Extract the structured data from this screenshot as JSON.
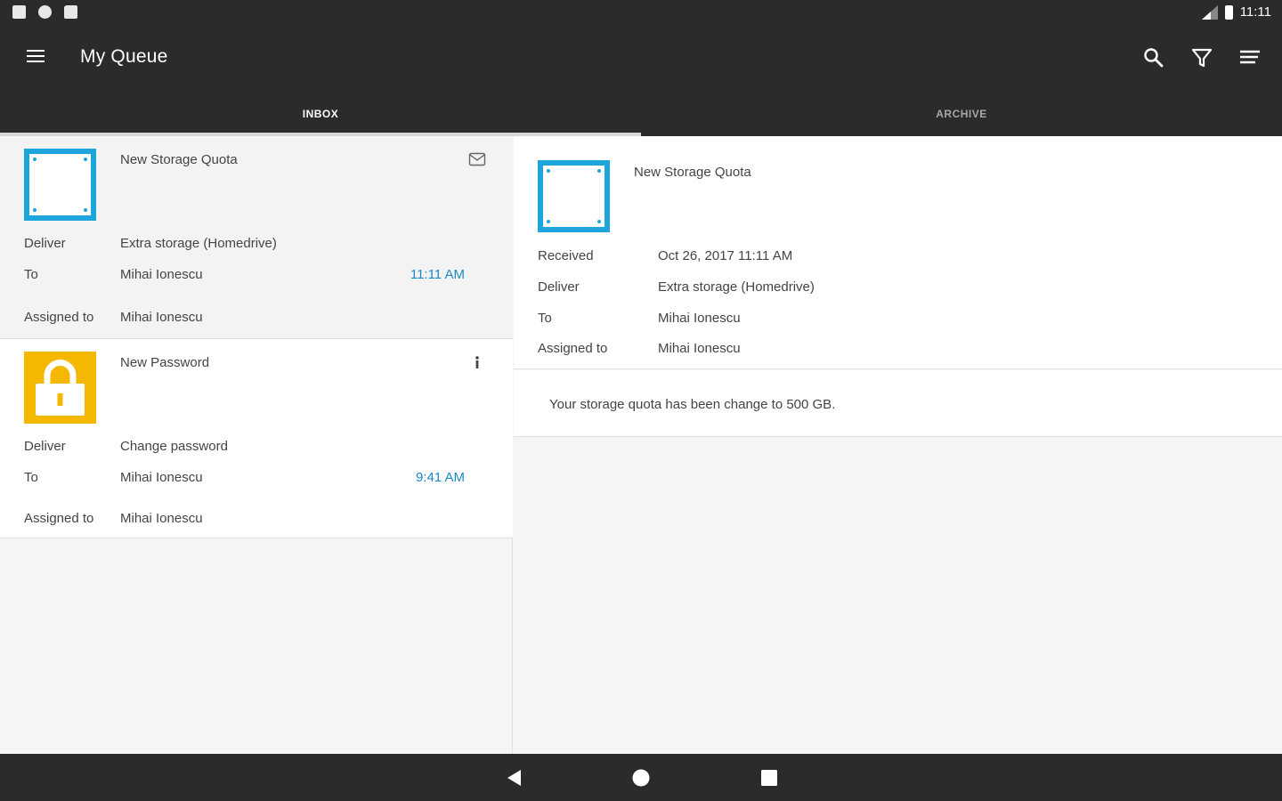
{
  "status_bar": {
    "time": "11:11"
  },
  "app_bar": {
    "title": "My Queue"
  },
  "tabs": [
    {
      "label": "INBOX",
      "active": true
    },
    {
      "label": "ARCHIVE",
      "active": false
    }
  ],
  "list": {
    "items": [
      {
        "title": "New Storage Quota",
        "icon": "mail-icon",
        "thumbnail": "storage-icon",
        "thumbnail_color": "#1ea5dc",
        "deliver_label": "Deliver",
        "deliver_value": "Extra storage (Homedrive)",
        "to_label": "To",
        "to_value": "Mihai Ionescu",
        "time": "11:11 AM",
        "assigned_label": "Assigned to",
        "assigned_value": "Mihai Ionescu"
      },
      {
        "title": "New Password",
        "icon": "info-icon",
        "thumbnail": "lock-icon",
        "thumbnail_color": "#f5b800",
        "deliver_label": "Deliver",
        "deliver_value": "Change password",
        "to_label": "To",
        "to_value": "Mihai Ionescu",
        "time": "9:41 AM",
        "assigned_label": "Assigned to",
        "assigned_value": "Mihai Ionescu"
      }
    ]
  },
  "detail": {
    "title": "New Storage Quota",
    "received_label": "Received",
    "received_value": "Oct 26, 2017 11:11 AM",
    "deliver_label": "Deliver",
    "deliver_value": "Extra storage (Homedrive)",
    "to_label": "To",
    "to_value": "Mihai Ionescu",
    "assigned_label": "Assigned to",
    "assigned_value": "Mihai Ionescu",
    "message": "Your storage quota has been change to 500 GB."
  },
  "colors": {
    "bar_background": "#2b2b2b",
    "accent_time": "#1a8ac8",
    "storage": "#1ea5dc",
    "lock": "#f5b800"
  }
}
